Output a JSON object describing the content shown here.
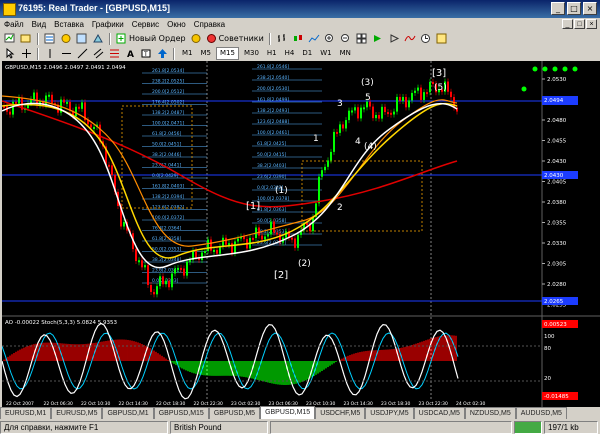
{
  "window": {
    "title": "76195: Real Trader - [GBPUSD,M15]",
    "minimize": "_",
    "maximize": "□",
    "close": "×"
  },
  "menu": {
    "items": [
      "Файл",
      "Вид",
      "Вставка",
      "Графики",
      "Сервис",
      "Окно",
      "Справка"
    ]
  },
  "toolbar": {
    "new_order": "Новый Ордер",
    "advisors": "Советники"
  },
  "timeframes": [
    "M1",
    "M5",
    "M15",
    "M30",
    "H1",
    "H4",
    "D1",
    "W1",
    "MN"
  ],
  "active_timeframe": "M15",
  "chart": {
    "info": "GBPUSD,M15 2.0496 2.0497 2.0491 2.0494",
    "current_price": "2.0494",
    "price_scale": [
      "2.0530",
      "2.0505",
      "2.0480",
      "2.0455",
      "2.0430",
      "2.0405",
      "2.0380",
      "2.0355",
      "2.0330",
      "2.0305",
      "2.0280",
      "2.0255"
    ],
    "marked_prices": [
      "2.0505",
      "2.0430",
      "2.0265"
    ],
    "wave_labels": [
      "3",
      "5",
      "(3)",
      "[3]",
      "(5)",
      "1",
      "4",
      "(4)",
      "(1)",
      "2",
      "[1]",
      "(2)",
      "[2]"
    ],
    "fib_levels_left": [
      "261.8[2.0534]",
      "238.2[2.0525]",
      "200.0[2.0512]",
      "176.4[2.0502]",
      "138.2[2.0487]",
      "100.0[2.0471]",
      "61.8[2.0456]",
      "50.0[2.0451]",
      "38.2[2.0446]",
      "23.6[2.0441]",
      "0.0[2.0429]",
      "161.8[2.0403]",
      "138.2[2.0394]",
      "123.6[2.0382]",
      "100.0[2.0372]",
      "76.4[2.0364]",
      "61.8[2.0358]",
      "50.0[2.0353]",
      "38.2[2.0348]",
      "23.6[2.0342]",
      "0.0[2.0333]"
    ],
    "fib_levels_right": [
      "261.8[2.0546]",
      "238.2[2.0540]",
      "200.0[2.0530]",
      "161.8[2.0499]",
      "138.2[2.0493]",
      "123.6[2.0488]",
      "100.0[2.0461]",
      "61.8[2.0425]",
      "50.0[2.0415]",
      "38.2[2.0403]",
      "23.6[2.0390]",
      "0.0[2.0382]",
      "100.0[2.0378]",
      "61.8[2.0363]",
      "50.0[2.0358]",
      "38.2[2.0353]",
      "23.6[2.0347]"
    ],
    "time_axis": [
      "22 Oct 2007",
      "22 Oct 06:30",
      "22 Oct 10:30",
      "22 Oct 14:30",
      "22 Oct 18:30",
      "22 Oct 22:30",
      "23 Oct 02:30",
      "23 Oct 06:30",
      "23 Oct 10:30",
      "23 Oct 14:30",
      "23 Oct 18:30",
      "23 Oct 22:30",
      "24 Oct 02:30"
    ]
  },
  "oscillator": {
    "label": "AO -0.00022 Stoch(5,3,3) 5.0824 5.9353",
    "scale": [
      "0.00523",
      "100",
      "80",
      "20",
      "-0.01485"
    ]
  },
  "colors": {
    "bg": "#000000",
    "bull": "#00ff00",
    "bear": "#ff0000",
    "level": "#1c3cff",
    "fib": "#5ab4ff",
    "ema_red": "#ff0000",
    "ema_yellow": "#ffd700",
    "ema_white": "#ffffff"
  },
  "tabs": [
    {
      "label": "EURUSD,M1",
      "active": false
    },
    {
      "label": "EURUSD,M5",
      "active": false
    },
    {
      "label": "GBPUSD,M1",
      "active": false
    },
    {
      "label": "GBPUSD,M15",
      "active": false
    },
    {
      "label": "GBPUSD,M5",
      "active": false
    },
    {
      "label": "GBPUSD,M15",
      "active": true
    },
    {
      "label": "USDCHF,M5",
      "active": false
    },
    {
      "label": "USDJPY,M5",
      "active": false
    },
    {
      "label": "USDCAD,M5",
      "active": false
    },
    {
      "label": "NZDUSD,M5",
      "active": false
    },
    {
      "label": "AUDUSD,M5",
      "active": false
    }
  ],
  "status": {
    "help": "Для справки, нажмите F1",
    "profile": "British Pound",
    "traffic": "197/1 kb"
  }
}
